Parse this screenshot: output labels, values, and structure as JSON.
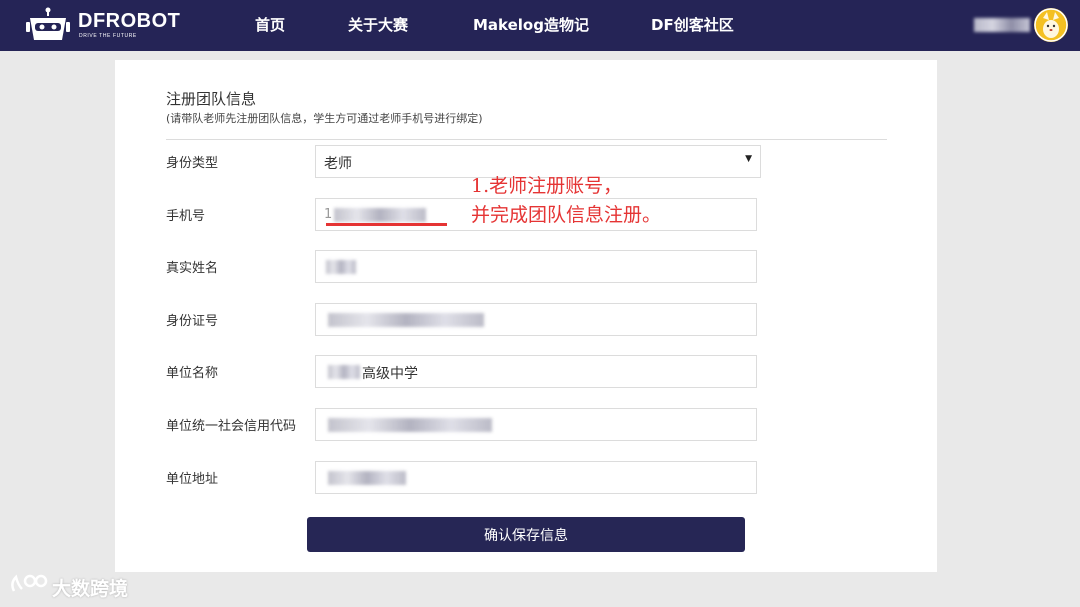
{
  "header": {
    "logo_text": "DFROBOT",
    "logo_tagline": "DRIVE THE FUTURE",
    "nav": [
      "首页",
      "关于大赛",
      "Makelog造物记",
      "DF创客社区"
    ],
    "colors": {
      "bg": "#252456",
      "text": "#ffffff",
      "avatar": "#f4c022"
    }
  },
  "form": {
    "title": "注册团队信息",
    "subtitle": "(请带队老师先注册团队信息，学生方可通过老师手机号进行绑定)",
    "fields": [
      {
        "label": "身份类型",
        "value": "老师",
        "type": "select"
      },
      {
        "label": "手机号",
        "value": "1",
        "type": "input"
      },
      {
        "label": "真实姓名",
        "value": "",
        "type": "input"
      },
      {
        "label": "身份证号",
        "value": "",
        "type": "input"
      },
      {
        "label": "单位名称",
        "value": "高级中学",
        "type": "input"
      },
      {
        "label": "单位统一社会信用代码",
        "value": "",
        "type": "input"
      },
      {
        "label": "单位地址",
        "value": "",
        "type": "input"
      }
    ],
    "submit_label": "确认保存信息",
    "colors": {
      "button_bg": "#262655",
      "annotation": "#e53434"
    }
  },
  "annotation": {
    "line1": "1.老师注册账号，",
    "line2": "并完成团队信息注册。"
  },
  "watermark": {
    "text": "大数跨境"
  },
  "icons": {
    "logo": "robot-logo-icon",
    "avatar": "avatar-icon",
    "select_arrow": "triangle-down-icon",
    "watermark": "watermark-logo-icon"
  }
}
